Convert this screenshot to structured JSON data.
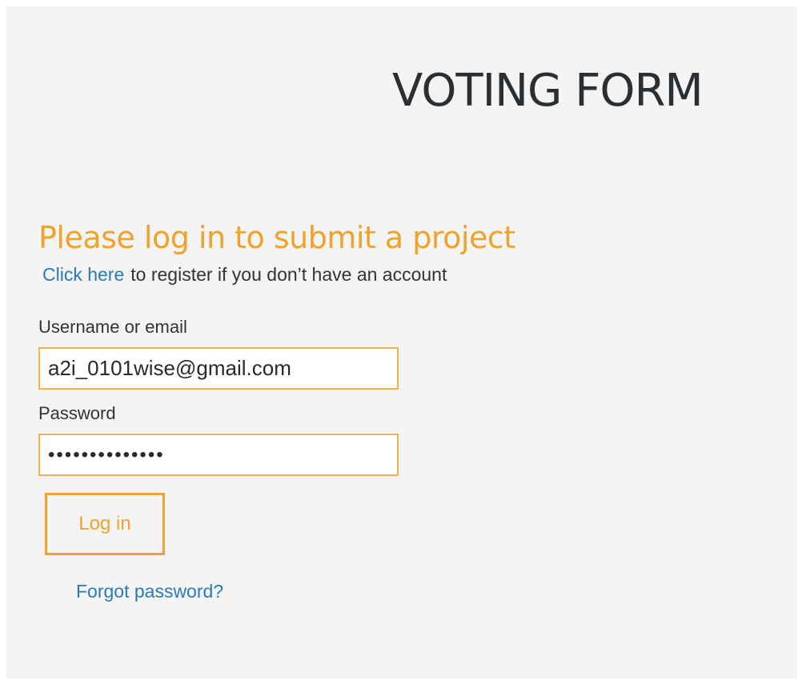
{
  "header": {
    "title": "VOTING FORM"
  },
  "login": {
    "heading": "Please log in to submit a project",
    "register_link": "Click here",
    "register_text": "to register if you don’t have an account",
    "username_label": "Username or email",
    "username_value": "a2i_0101wise@gmail.com",
    "password_label": "Password",
    "password_value": "••••••••••••••",
    "submit_label": "Log in",
    "forgot_label": "Forgot password?"
  },
  "colors": {
    "accent": "#f0a22b",
    "link": "#2a7ab8",
    "panel_bg": "#f4f4f4"
  }
}
